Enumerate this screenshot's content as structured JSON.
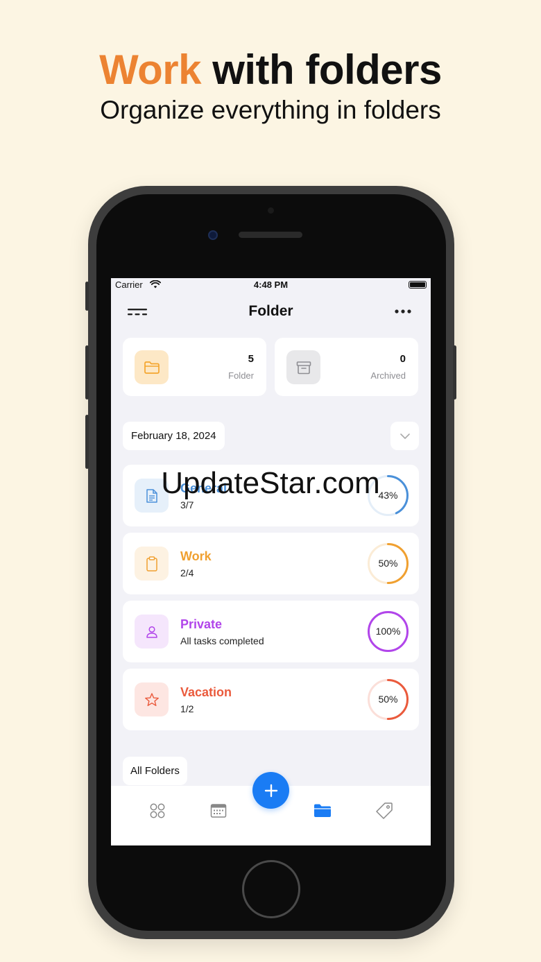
{
  "promo": {
    "headline_accent": "Work",
    "headline_rest": " with folders",
    "subheadline": "Organize everything in folders"
  },
  "status_bar": {
    "carrier": "Carrier",
    "time": "4:48 PM"
  },
  "nav": {
    "title": "Folder",
    "menu_icon": "menu-lines-icon",
    "more_icon": "more-dots-icon"
  },
  "stats": [
    {
      "count": "5",
      "label": "Folder",
      "icon": "folder-icon",
      "color": "#f4a52e"
    },
    {
      "count": "0",
      "label": "Archived",
      "icon": "archive-box-icon",
      "color": "#8e8e93"
    }
  ],
  "date_label": "February 18, 2024",
  "folders": [
    {
      "name": "General",
      "sub": "3/7",
      "percent": "43%",
      "progress": 0.43,
      "color": "#4a90d9",
      "icon": "document-icon"
    },
    {
      "name": "Work",
      "sub": "2/4",
      "percent": "50%",
      "progress": 0.5,
      "color": "#f0a030",
      "icon": "clipboard-icon"
    },
    {
      "name": "Private",
      "sub": "All tasks completed",
      "percent": "100%",
      "progress": 1.0,
      "color": "#b145ea",
      "icon": "person-icon"
    },
    {
      "name": "Vacation",
      "sub": "1/2",
      "percent": "50%",
      "progress": 0.5,
      "color": "#ea5a3c",
      "icon": "star-icon"
    }
  ],
  "all_folders_label": "All Folders",
  "tabbar": {
    "tabs": [
      "grid-icon",
      "calendar-icon",
      "folder-icon",
      "tag-icon"
    ],
    "active": "folder-icon",
    "active_color": "#1a7cf4",
    "fab_icon": "plus-icon"
  },
  "watermark": "UpdateStar.com"
}
